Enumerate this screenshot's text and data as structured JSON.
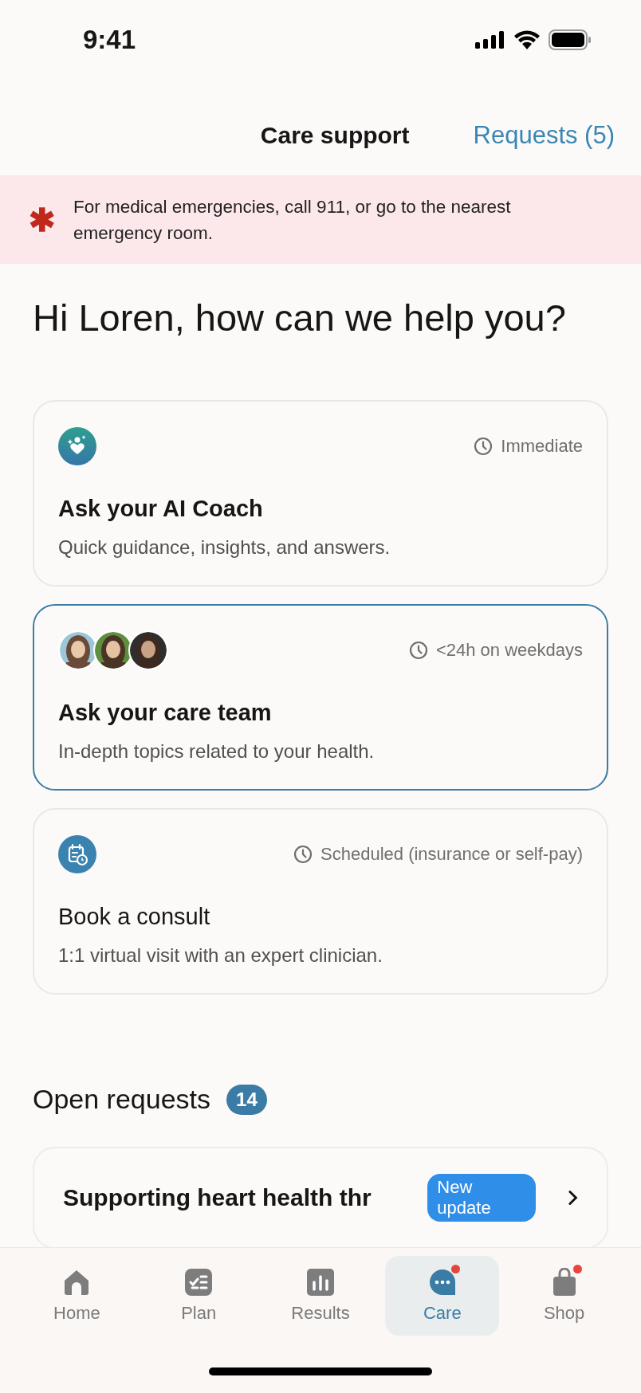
{
  "status_bar": {
    "time": "9:41"
  },
  "header": {
    "title": "Care support",
    "requests_link": "Requests (5)"
  },
  "emergency_banner": {
    "icon": "✱",
    "text": "For medical emergencies, call 911, or go to the nearest emergency room."
  },
  "greeting": "Hi Loren, how can we help you?",
  "options": [
    {
      "kind": "ai-coach",
      "timing": "Immediate",
      "title": "Ask your AI Coach",
      "description": "Quick guidance, insights, and answers.",
      "selected": false
    },
    {
      "kind": "care-team",
      "timing": "<24h on weekdays",
      "title": "Ask your care team",
      "description": "In-depth topics related to your health.",
      "selected": true
    },
    {
      "kind": "consult",
      "timing": "Scheduled (insurance or self-pay)",
      "title": "Book a consult",
      "description": "1:1 virtual visit with an expert clinician.",
      "selected": false
    }
  ],
  "open_requests": {
    "title": "Open requests",
    "count": "14",
    "items": [
      {
        "title": "Supporting heart health thr",
        "badge": "New update"
      }
    ]
  },
  "tab_bar": [
    {
      "label": "Home",
      "selected": false,
      "notification": false
    },
    {
      "label": "Plan",
      "selected": false,
      "notification": false
    },
    {
      "label": "Results",
      "selected": false,
      "notification": false
    },
    {
      "label": "Care",
      "selected": true,
      "notification": true
    },
    {
      "label": "Shop",
      "selected": false,
      "notification": true
    }
  ]
}
